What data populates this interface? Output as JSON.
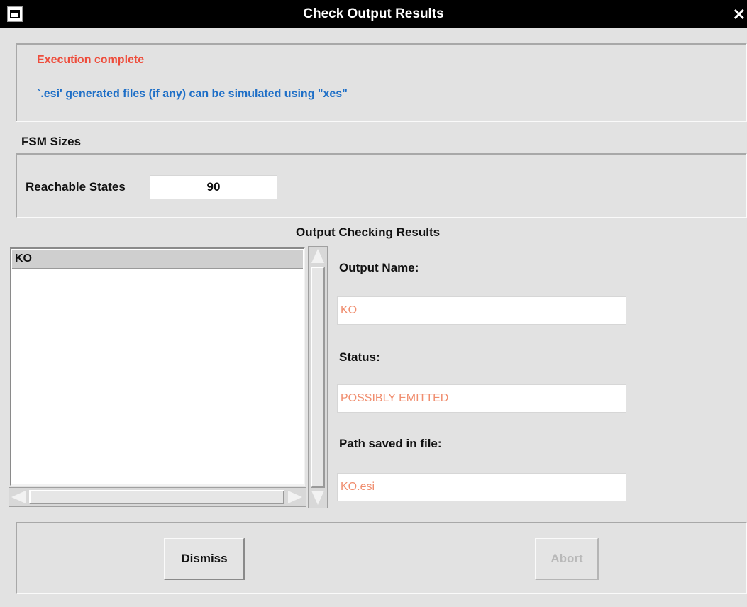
{
  "window": {
    "title": "Check Output Results"
  },
  "messages": {
    "status": "Execution complete",
    "info": "`.esi' generated files (if any) can be simulated using \"xes\""
  },
  "fsm": {
    "heading": "FSM Sizes",
    "reachable_label": "Reachable States",
    "reachable_value": "90"
  },
  "results": {
    "heading": "Output Checking Results",
    "outputs": [
      "KO"
    ],
    "output_name_label": "Output Name:",
    "output_name_value": "KO",
    "status_label": "Status:",
    "status_value": "POSSIBLY EMITTED",
    "path_label": "Path saved in file:",
    "path_value": "KO.esi"
  },
  "buttons": {
    "dismiss": "Dismiss",
    "abort": "Abort",
    "abort_enabled": false
  },
  "colors": {
    "titlebar": "#000000",
    "background": "#e2e2e2",
    "status_text": "#ee4d3c",
    "info_text": "#1e6fc7",
    "field_value": "#f08d6e"
  },
  "icons": [
    "window-menu-icon",
    "close-icon",
    "scroll-up-arrow-icon",
    "scroll-down-arrow-icon",
    "scroll-left-arrow-icon",
    "scroll-right-arrow-icon"
  ]
}
